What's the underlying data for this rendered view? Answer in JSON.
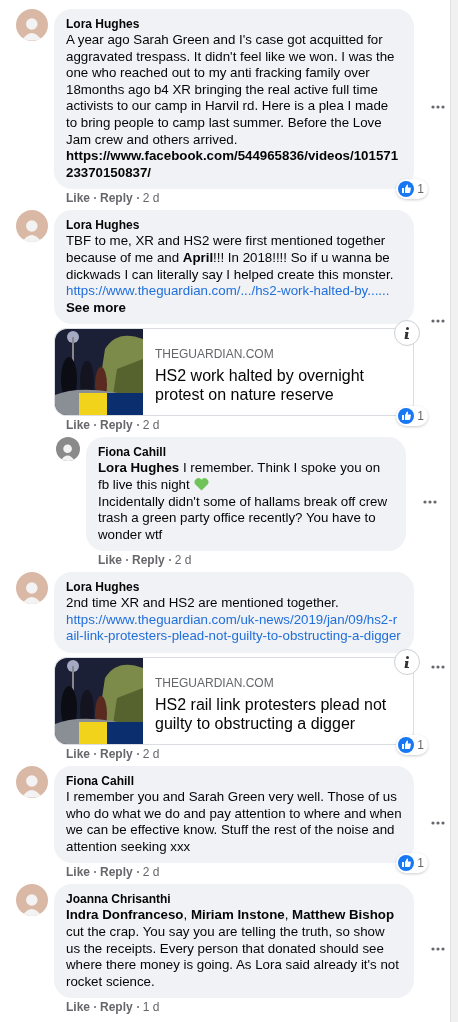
{
  "comments": [
    {
      "kind": "comment",
      "author": "Lora Hughes",
      "paragraphs": [
        "A year ago Sarah Green and I's case got acquitted for aggravated trespass. It didn't feel like we won. I was the one who reached out to my anti fracking family over 18months ago b4 XR bringing the real active full time activists to our camp in Harvil rd. Here is a plea I made to bring people to camp last summer. Before the Love Jam crew and others arrived."
      ],
      "link": {
        "text": "https://www.facebook.com/544965836/videos/10157123370150837/",
        "kind": "video"
      },
      "reactions": "1",
      "actions": [
        "Like",
        "Reply",
        "2 d"
      ]
    },
    {
      "kind": "comment",
      "author": "Lora Hughes",
      "paragraphs": [
        "TBF to me, XR and HS2 were first mentioned together because of me and **April**!!! In 2018!!!! So if u wanna be dickwads I can literally say I helped create this monster."
      ],
      "link": {
        "text": "https://www.theguardian.com/.../hs2-work-halted-by......",
        "kind": "article"
      },
      "see_more": "See more",
      "preview": {
        "domain": "THEGUARDIAN.COM",
        "title": "HS2 work halted by overnight protest on nature reserve"
      },
      "reactions": "1",
      "actions": [
        "Like",
        "Reply",
        "2 d"
      ]
    },
    {
      "kind": "reply",
      "author": "Fiona Cahill",
      "paragraphs": [
        "**Lora Hughes** I remember. Think I spoke you on fb live this night",
        "Incidentally didn't some of hallams break off crew trash a green party office recently? You have to wonder wtf"
      ],
      "heart_emoji": true,
      "actions": [
        "Like",
        "Reply",
        "2 d"
      ]
    },
    {
      "kind": "comment",
      "author": "Lora Hughes",
      "paragraphs": [
        "2nd time XR and HS2 are mentioned together."
      ],
      "link": {
        "text": "https://www.theguardian.com/uk-news/2019/jan/09/hs2-rail-link-protesters-plead-not-guilty-to-obstructing-a-digger",
        "kind": "article"
      },
      "preview": {
        "domain": "THEGUARDIAN.COM",
        "title": "HS2 rail link protesters plead not guilty to obstructing a digger"
      },
      "reactions": "1",
      "actions": [
        "Like",
        "Reply",
        "2 d"
      ]
    },
    {
      "kind": "comment",
      "author": "Fiona Cahill",
      "paragraphs": [
        "I remember you and Sarah Green very well. Those of us who do what we do and pay attention to where and when we can be effective know. Stuff the rest of the noise and attention seeking xxx"
      ],
      "reactions": "1",
      "actions": [
        "Like",
        "Reply",
        "2 d"
      ]
    },
    {
      "kind": "comment",
      "author": "Joanna Chrisanthi",
      "paragraphs": [
        "**Indra Donfranceso**, **Miriam Instone**, **Matthew Bishop** cut the crap. You say you are telling the truth, so show us the receipts. Every person that donated should see where there money is going. As Lora said already it's not rocket science."
      ],
      "actions": [
        "Like",
        "Reply",
        "1 d"
      ]
    }
  ]
}
